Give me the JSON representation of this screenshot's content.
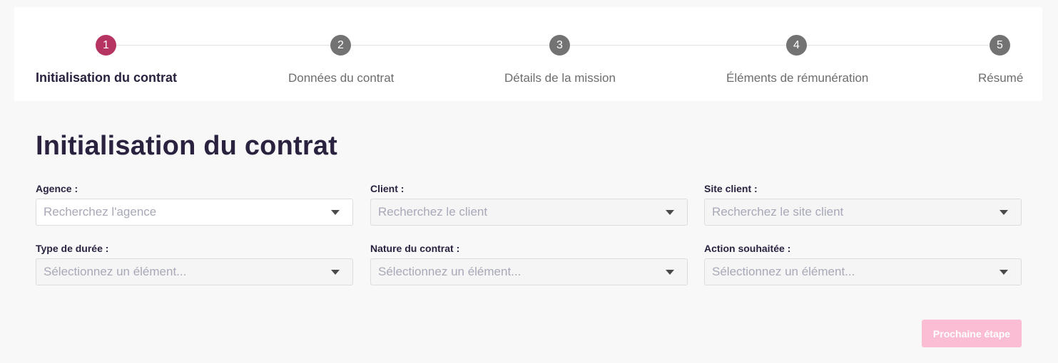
{
  "stepper": {
    "steps": [
      {
        "number": "1",
        "label": "Initialisation du contrat",
        "active": true
      },
      {
        "number": "2",
        "label": "Données du contrat",
        "active": false
      },
      {
        "number": "3",
        "label": "Détails de la mission",
        "active": false
      },
      {
        "number": "4",
        "label": "Éléments de rémunération",
        "active": false
      },
      {
        "number": "5",
        "label": "Résumé",
        "active": false
      }
    ]
  },
  "colors": {
    "active_step": "#b63462",
    "inactive_step": "#737373",
    "title_text": "#2b2240",
    "disabled_button": "#fbbdd3",
    "placeholder": "#a8a9b8"
  },
  "page": {
    "title": "Initialisation du contrat"
  },
  "form": {
    "agence": {
      "label": "Agence :",
      "placeholder": "Recherchez l'agence",
      "value": "",
      "icon": "chevron-down-icon"
    },
    "client": {
      "label": "Client :",
      "placeholder": "Recherchez le client",
      "value": "",
      "icon": "chevron-down-icon"
    },
    "site_client": {
      "label": "Site client :",
      "placeholder": "Recherchez le site client",
      "value": "",
      "icon": "chevron-down-icon"
    },
    "type_duree": {
      "label": "Type de durée :",
      "placeholder": "Sélectionnez un élément...",
      "value": "",
      "icon": "chevron-down-icon"
    },
    "nature_contrat": {
      "label": "Nature du contrat :",
      "placeholder": "Sélectionnez un élément...",
      "value": "",
      "icon": "chevron-down-icon"
    },
    "action_souhaitee": {
      "label": "Action souhaitée :",
      "placeholder": "Sélectionnez un élément...",
      "value": "",
      "icon": "chevron-down-icon"
    }
  },
  "actions": {
    "next_label": "Prochaine étape"
  }
}
